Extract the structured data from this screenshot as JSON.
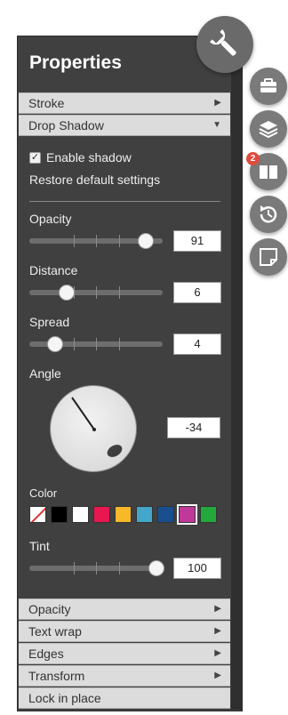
{
  "panel": {
    "title": "Properties"
  },
  "sections_top": [
    {
      "label": "Stroke",
      "arrow": "▶"
    },
    {
      "label": "Drop Shadow",
      "arrow": "▼"
    }
  ],
  "drop_shadow": {
    "enable_label": "Enable shadow",
    "enabled": true,
    "restore_label": "Restore default settings",
    "opacity": {
      "label": "Opacity",
      "value": "91",
      "fraction": 0.87
    },
    "distance": {
      "label": "Distance",
      "value": "6",
      "fraction": 0.28
    },
    "spread": {
      "label": "Spread",
      "value": "4",
      "fraction": 0.19
    },
    "angle": {
      "label": "Angle",
      "value": "-34"
    },
    "color": {
      "label": "Color",
      "swatches": [
        "none",
        "#000000",
        "#ffffff",
        "#e8174f",
        "#f7b829",
        "#43a7c9",
        "#194f8f",
        "#c0399a",
        "#23a83b"
      ],
      "selected": "#c0399a"
    },
    "tint": {
      "label": "Tint",
      "value": "100",
      "fraction": 0.95
    }
  },
  "sections_bottom": [
    {
      "label": "Opacity",
      "arrow": "▶"
    },
    {
      "label": "Text wrap",
      "arrow": "▶"
    },
    {
      "label": "Edges",
      "arrow": "▶"
    },
    {
      "label": "Transform",
      "arrow": "▶"
    },
    {
      "label": "Lock in place",
      "arrow": ""
    }
  ],
  "side_toolbar": {
    "buttons": [
      "briefcase-icon",
      "layers-icon",
      "book-icon",
      "history-icon",
      "note-icon"
    ],
    "badge": "2"
  }
}
